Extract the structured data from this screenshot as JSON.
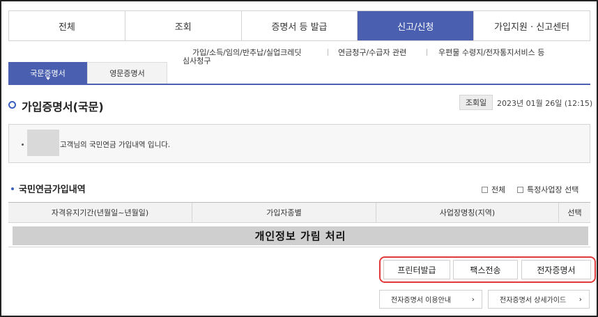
{
  "top_tabs": [
    {
      "label": "전체"
    },
    {
      "label": "조회"
    },
    {
      "label": "증명서 등 발급"
    },
    {
      "label": "신고/신청"
    },
    {
      "label": "가입지원 · 신고센터"
    }
  ],
  "submenu": {
    "item1_line1": "가입/소득/임의/반추납/실업크레딧",
    "item1_line2": "심사청구",
    "item2": "연금청구/수급자 관련",
    "item3": "우편물 수령지/전자통지서비스 등"
  },
  "doc_tabs": {
    "domestic": "국문증명서",
    "english": "영문증명서"
  },
  "page_title": "가입증명서(국문)",
  "date": {
    "label": "조회일",
    "value": "2023년 01월 26일 (12:15)"
  },
  "info": {
    "bullet": "·",
    "text": "고객님의 국민연금 가입내역 입니다."
  },
  "section": {
    "title": "국민연금가입내역",
    "check_all": "전체",
    "check_specific": "특정사업장 선택"
  },
  "table": {
    "headers": [
      "자격유지기간(년월일~년월일)",
      "가입자종별",
      "사업장명칭(지역)",
      "선택"
    ],
    "mask_text": "개인정보 가림 처리"
  },
  "actions": {
    "print": "프린터발급",
    "fax": "팩스전송",
    "electronic": "전자증명서"
  },
  "guides": {
    "usage": "전자증명서 이용안내",
    "detail": "전자증명서 상세가이드",
    "arrow": "›"
  },
  "colors": {
    "accent": "#4a5fb0",
    "highlight": "#e03a3a"
  }
}
